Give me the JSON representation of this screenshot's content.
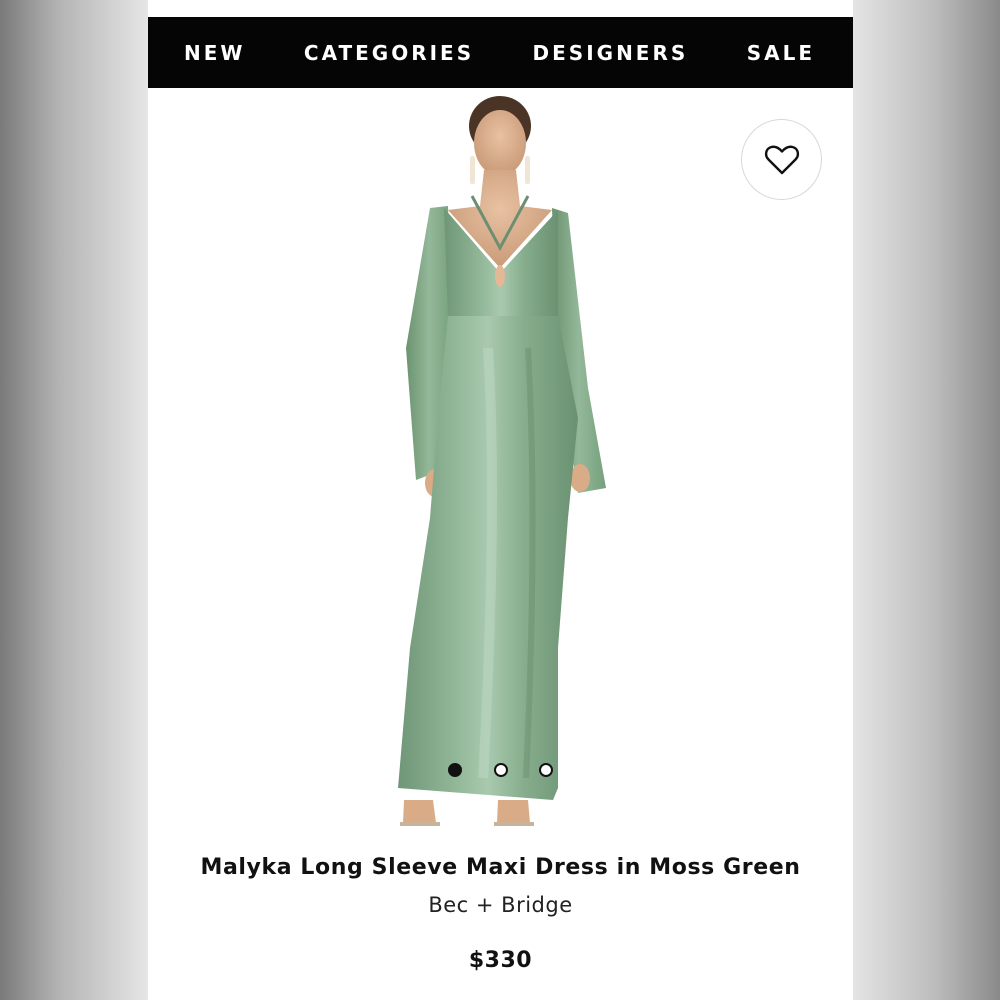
{
  "nav": {
    "items": [
      {
        "label": "NEW"
      },
      {
        "label": "CATEGORIES"
      },
      {
        "label": "DESIGNERS"
      },
      {
        "label": "SALE"
      }
    ]
  },
  "product": {
    "title": "Malyka Long Sleeve Maxi Dress in Moss Green",
    "brand": "Bec + Bridge",
    "price": "$330",
    "image_icon": "dress-photo",
    "dress_color": "#7fa585"
  },
  "gallery": {
    "count": 3,
    "active_index": 0
  },
  "wishlist": {
    "icon": "heart-outline-icon"
  }
}
